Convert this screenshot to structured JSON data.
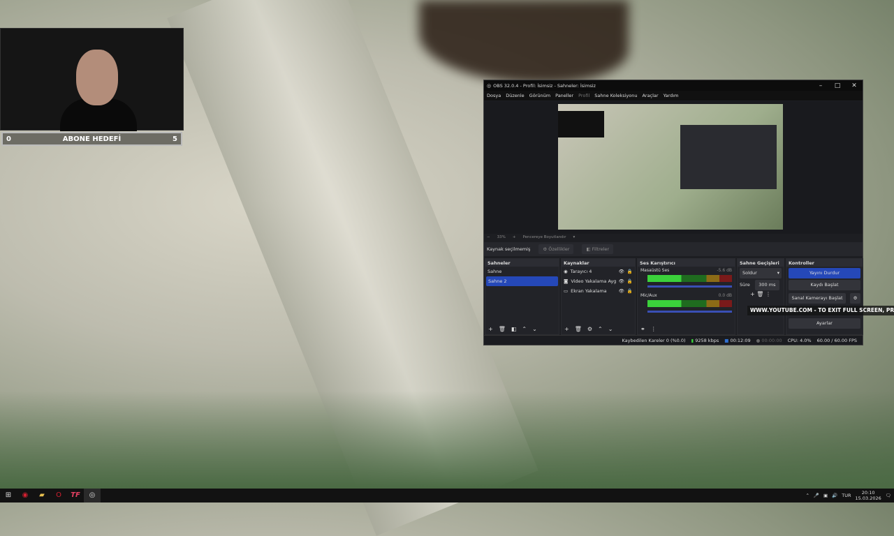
{
  "overlay": {
    "goal_label": "ABONE HEDEFİ",
    "goal_current": "0",
    "goal_target": "5",
    "youtube_notice": "WWW.YOUTUBE.COM - TO EXIT FULL SCREEN, PRESS"
  },
  "obs": {
    "title": "OBS 32.0.4 - Profil: İsimsiz - Sahneler: İsimsiz",
    "menu": [
      "Dosya",
      "Düzenle",
      "Görünüm",
      "Paneller",
      "Profil",
      "Sahne Koleksiyonu",
      "Araçlar",
      "Yardım"
    ],
    "zoom": "33%",
    "fit": "Pencereye Boyutlandır",
    "source_bar": {
      "status": "Kaynak seçilmemiş",
      "properties": "Özellikler",
      "filters": "Filtreler"
    },
    "scenes": {
      "title": "Sahneler",
      "items": [
        "Sahne",
        "Sahne 2"
      ],
      "selected": "Sahne 2"
    },
    "sources": {
      "title": "Kaynaklar",
      "items": [
        {
          "name": "Tarayıcı 4",
          "icon": "globe-icon"
        },
        {
          "name": "Video Yakalama Aygıtı",
          "icon": "camera-icon"
        },
        {
          "name": "Ekran Yakalama",
          "icon": "monitor-icon"
        }
      ]
    },
    "mixer": {
      "title": "Ses Karıştırıcı",
      "channels": [
        {
          "name": "Masaüstü Ses",
          "db": "-5.6 dB",
          "level": 0.45
        },
        {
          "name": "Mic/Aux",
          "db": "0.0 dB",
          "level": 0.25
        }
      ],
      "scale": [
        "-60",
        "-55",
        "-50",
        "-45",
        "-40",
        "-35",
        "-30",
        "-25",
        "-20",
        "-15",
        "-10",
        "-5",
        "0"
      ]
    },
    "transitions": {
      "title": "Sahne Geçişleri",
      "selected": "Soldur",
      "duration_label": "Süre",
      "duration": "300 ms"
    },
    "controls": {
      "title": "Kontroller",
      "stop_stream": "Yayını Durdur",
      "start_record": "Kaydı Başlat",
      "virtual_cam": "Sanal Kamerayı Başlat",
      "settings": "Ayarlar"
    },
    "status": {
      "dropped": "Kaybedilen Kareler 0 (%0.0)",
      "bitrate": "9258 kbps",
      "stream_time": "00:12:09",
      "record_time": "00:00:00",
      "cpu": "CPU: 4.0%",
      "fps": "60.00 / 60.00 FPS"
    },
    "accent": "#2548b8"
  },
  "taskbar": {
    "lang": "TUR",
    "time": "20:10",
    "date": "15.03.2026"
  }
}
